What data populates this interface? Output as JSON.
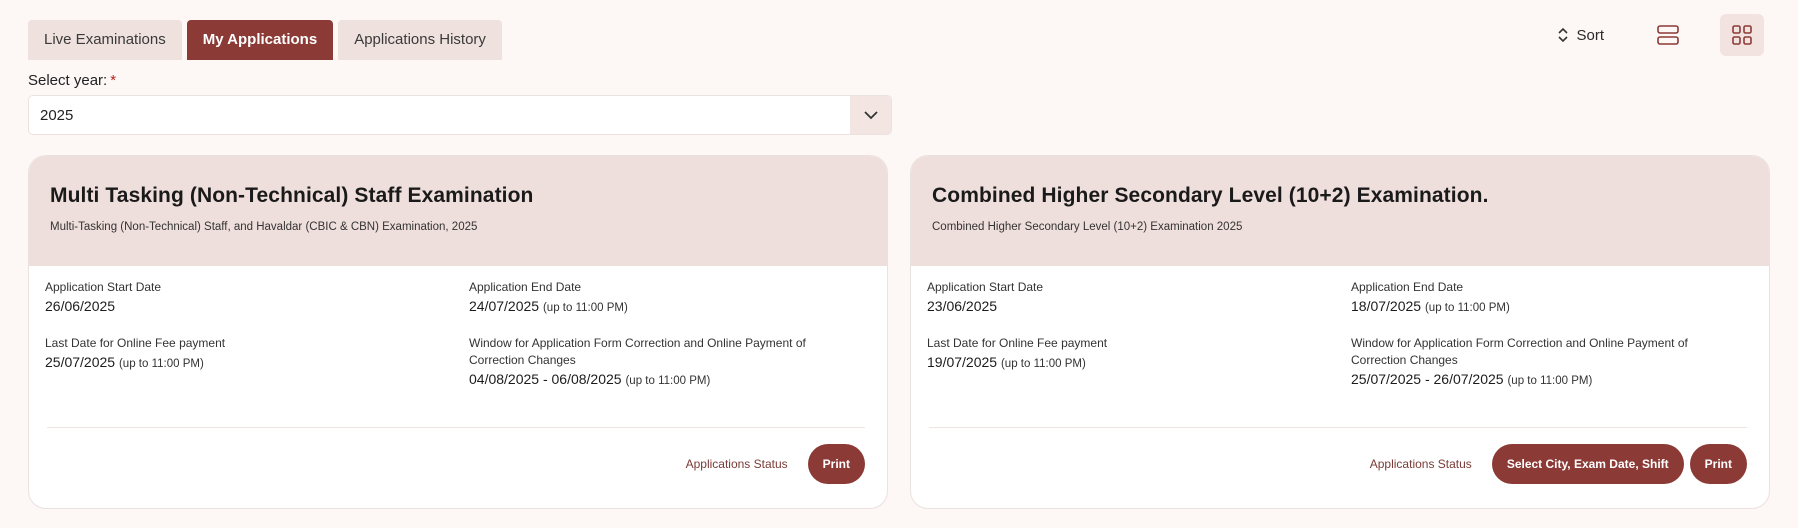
{
  "tabs": [
    {
      "label": "Live Examinations",
      "active": false
    },
    {
      "label": "My Applications",
      "active": true
    },
    {
      "label": "Applications History",
      "active": false
    }
  ],
  "toolbar": {
    "sort_label": "Sort",
    "list_view_icon": "list-view-icon",
    "grid_view_icon": "grid-view-icon"
  },
  "year_filter": {
    "label": "Select year:",
    "required_mark": "*",
    "value": "2025"
  },
  "cards": [
    {
      "title": "Multi Tasking (Non-Technical) Staff Examination",
      "subtitle": "Multi-Tasking (Non-Technical) Staff, and Havaldar (CBIC & CBN) Examination, 2025",
      "start_label": "Application Start Date",
      "start_date": "26/06/2025",
      "end_label": "Application End Date",
      "end_date": "24/07/2025",
      "end_note": "(up to 11:00 PM)",
      "fee_label": "Last Date for Online Fee payment",
      "fee_date": "25/07/2025",
      "fee_note": "(up to 11:00 PM)",
      "correction_label": "Window for Application Form Correction and Online Payment of Correction Changes",
      "correction_dates": "04/08/2025 - 06/08/2025",
      "correction_note": "(up to 11:00 PM)",
      "status_link": "Applications Status",
      "buttons": [
        "Print"
      ]
    },
    {
      "title": "Combined Higher Secondary Level (10+2) Examination.",
      "subtitle": "Combined Higher Secondary Level (10+2) Examination 2025",
      "start_label": "Application Start Date",
      "start_date": "23/06/2025",
      "end_label": "Application End Date",
      "end_date": "18/07/2025",
      "end_note": "(up to 11:00 PM)",
      "fee_label": "Last Date for Online Fee payment",
      "fee_date": "19/07/2025",
      "fee_note": "(up to 11:00 PM)",
      "correction_label": "Window for Application Form Correction and Online Payment of Correction Changes",
      "correction_dates": "25/07/2025 - 26/07/2025",
      "correction_note": "(up to 11:00 PM)",
      "status_link": "Applications Status",
      "buttons": [
        "Select City, Exam Date, Shift",
        "Print"
      ]
    }
  ],
  "colors": {
    "accent": "#8b3a36",
    "card_header": "#efdfdc",
    "background": "#fdf7f6"
  }
}
